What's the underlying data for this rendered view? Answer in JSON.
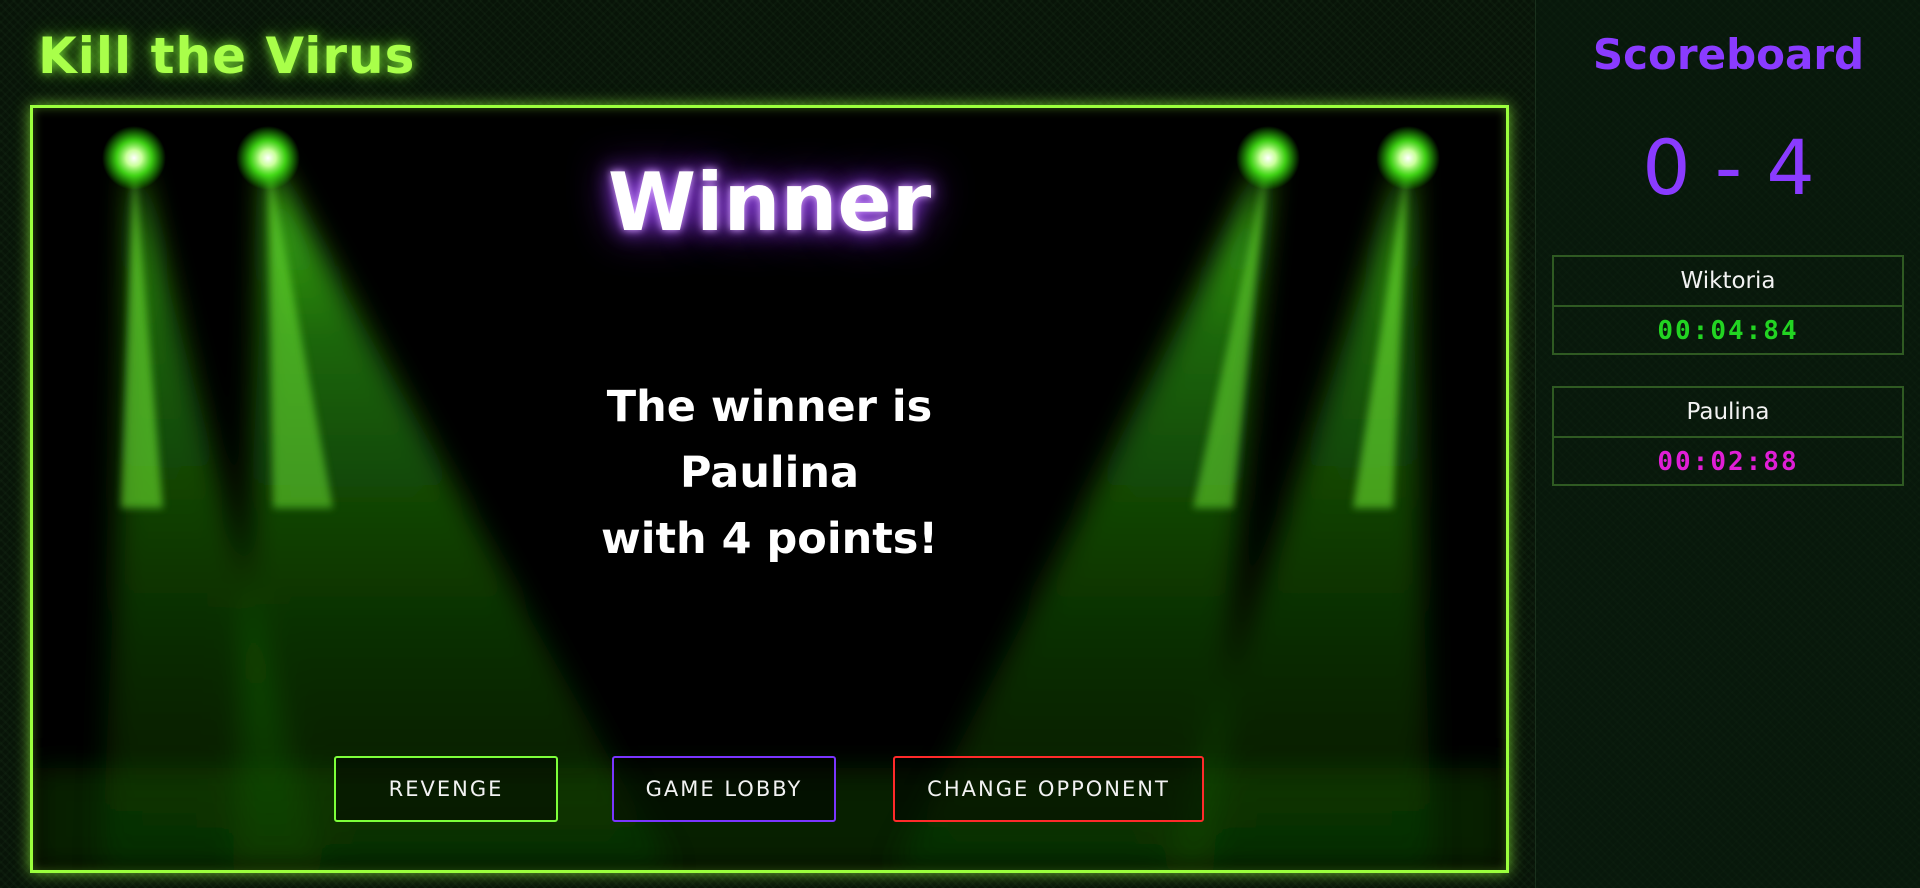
{
  "app": {
    "title": "Kill the Virus"
  },
  "stage": {
    "heading": "Winner",
    "message": [
      "The winner is",
      "Paulina",
      "with 4 points!"
    ]
  },
  "buttons": {
    "revenge": "REVENGE",
    "lobby": "GAME LOBBY",
    "change_opponent": "CHANGE OPPONENT"
  },
  "scoreboard": {
    "title": "Scoreboard",
    "score": "0 - 4",
    "players": [
      {
        "name": "Wiktoria",
        "time": "00:04:84",
        "color": "#22d422"
      },
      {
        "name": "Paulina",
        "time": "00:02:88",
        "color": "#e01ed6"
      }
    ]
  },
  "colors": {
    "accent_green": "#9bff3d",
    "accent_purple": "#8a3bff",
    "accent_red": "#ff2a2a",
    "spotlight": "#3aff1a"
  }
}
